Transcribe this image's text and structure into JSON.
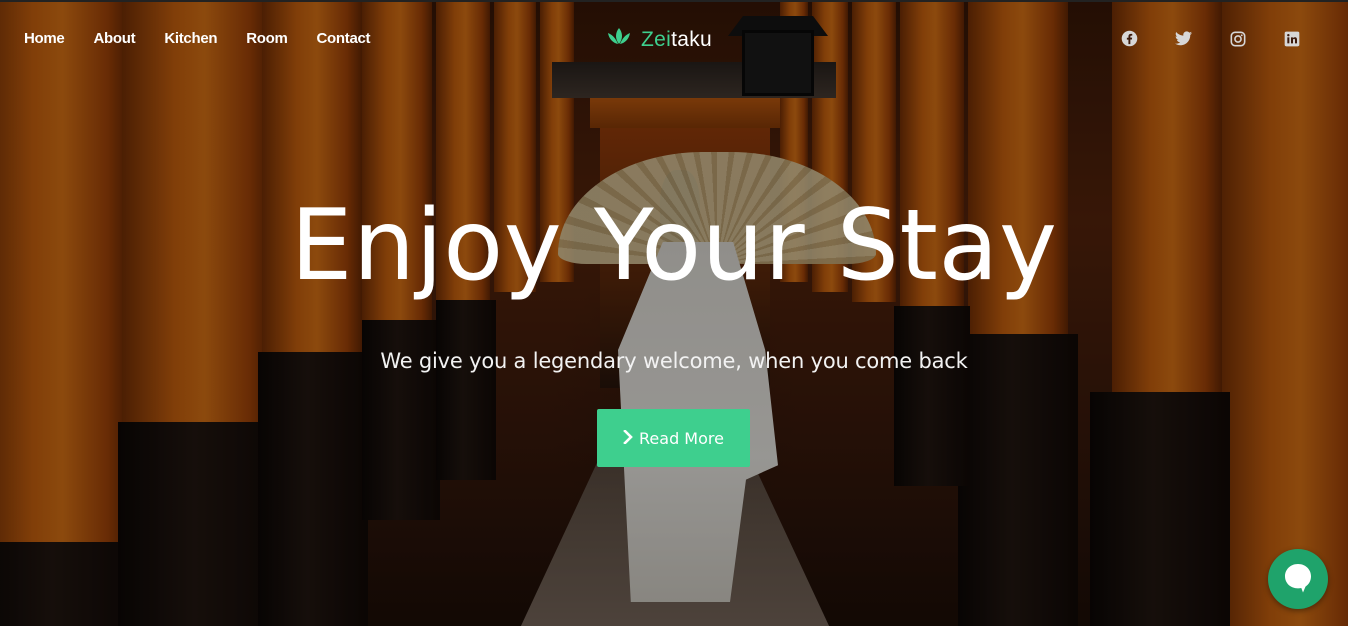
{
  "nav": {
    "items": [
      {
        "label": "Home"
      },
      {
        "label": "About"
      },
      {
        "label": "Kitchen"
      },
      {
        "label": "Room"
      },
      {
        "label": "Contact"
      }
    ]
  },
  "brand": {
    "accent_part": "Zei",
    "rest_part": "taku",
    "logo_icon": "lotus-icon",
    "accent_color": "#3ecf8e"
  },
  "social": {
    "icons": [
      "facebook-icon",
      "twitter-icon",
      "instagram-icon",
      "linkedin-icon"
    ]
  },
  "hero": {
    "headline": "Enjoy Your Stay",
    "subline": "We give you a legendary welcome, when you come back",
    "cta_label": "Read More",
    "cta_icon": "chevron-right-icon",
    "cta_color": "#3ecf8e"
  },
  "chat": {
    "icon": "chat-bubble-icon",
    "color": "#1fa36b"
  }
}
